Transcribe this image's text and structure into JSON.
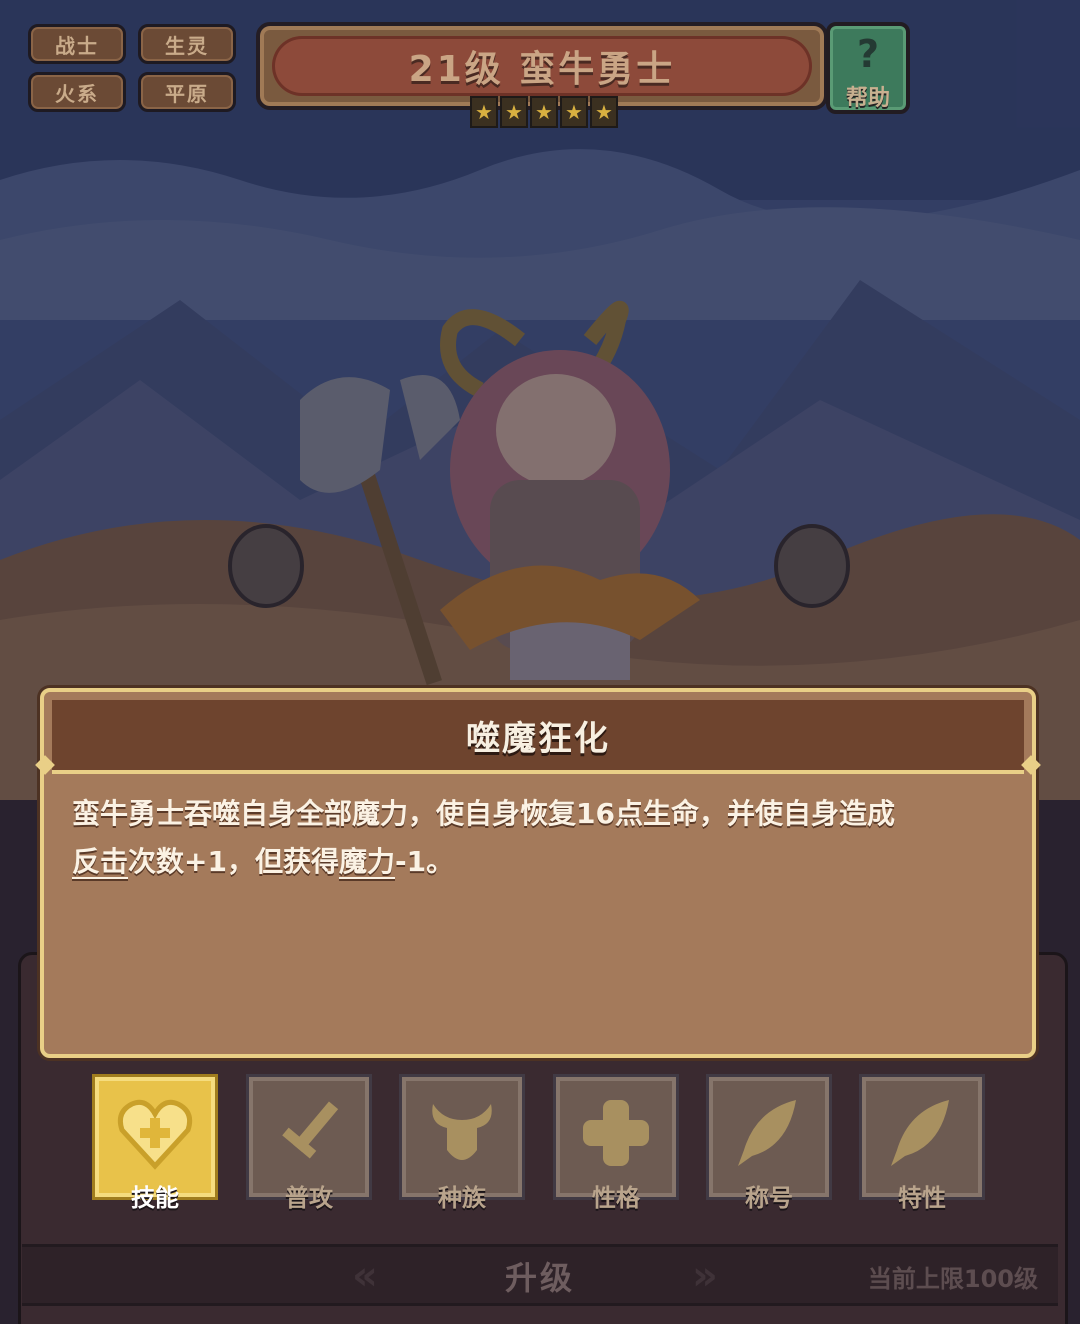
{
  "tags": {
    "class": "战士",
    "race": "生灵",
    "element": "火系",
    "terrain": "平原"
  },
  "header": {
    "title": "21级  蛮牛勇士",
    "stars": [
      "★",
      "★",
      "★",
      "★",
      "★"
    ],
    "help_label": "帮助",
    "help_glyph": "?"
  },
  "skill_popup": {
    "title": "噬魔狂化",
    "text_1": "蛮牛勇士吞噬自身全部魔力，使自身恢复16点生命，并使自身造成",
    "link_1": "反击",
    "text_2": "次数+1，但获得",
    "link_2": "魔力",
    "text_3": "-1。"
  },
  "tabs": [
    {
      "label": "技能",
      "icon": "heart-badge-icon",
      "active": true
    },
    {
      "label": "普攻",
      "icon": "sword-icon",
      "active": false
    },
    {
      "label": "种族",
      "icon": "bull-head-icon",
      "active": false
    },
    {
      "label": "性格",
      "icon": "cross-icon",
      "active": false
    },
    {
      "label": "称号",
      "icon": "feather-icon",
      "active": false
    },
    {
      "label": "特性",
      "icon": "feather-icon",
      "active": false
    }
  ],
  "upgrade": {
    "label": "升级",
    "cap": "当前上限100级"
  },
  "colors": {
    "active_tab": "#e8c24a",
    "popup_border": "#e9cf87",
    "popup_bg": "#a47a5b",
    "popup_header": "#6e442e"
  }
}
